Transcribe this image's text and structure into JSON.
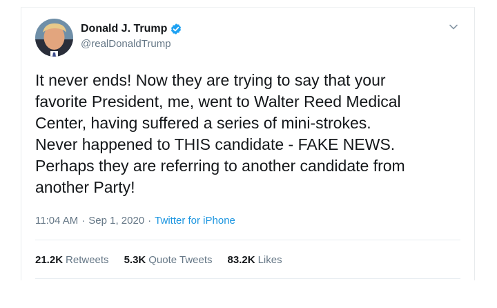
{
  "author": {
    "name": "Donald J. Trump",
    "handle": "@realDonaldTrump",
    "avatar_icon": "profile-photo",
    "verified_icon": "verified-badge-icon",
    "verified_color": "#1da1f2"
  },
  "menu_icon": "chevron-down-icon",
  "tweet": {
    "text": "It never ends! Now they are trying to say that your\nfavorite President, me, went to Walter Reed Medical\nCenter, having suffered a series of mini-strokes.\nNever happened to THIS candidate - FAKE NEWS.\nPerhaps they are referring to another candidate from\nanother Party!"
  },
  "meta": {
    "time": "11:04 AM",
    "separator1": "·",
    "date": "Sep 1, 2020",
    "separator2": "·",
    "source": "Twitter for iPhone",
    "source_color": "#1b95e0"
  },
  "stats": {
    "retweets_count": "21.2K",
    "retweets_label": "Retweets",
    "quotes_count": "5.3K",
    "quotes_label": "Quote Tweets",
    "likes_count": "83.2K",
    "likes_label": "Likes"
  }
}
